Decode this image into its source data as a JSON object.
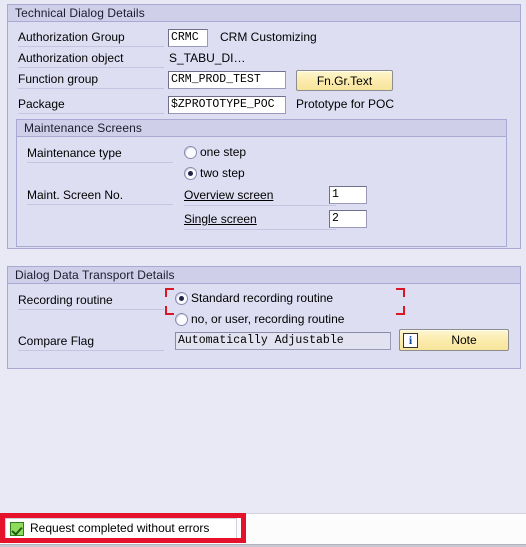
{
  "technical_dialog": {
    "title": "Technical Dialog Details",
    "rows": [
      {
        "label": "Authorization Group",
        "value": "CRMC",
        "description": "CRM Customizing"
      },
      {
        "label": "Authorization object",
        "value": "S_TABU_DI…",
        "description": ""
      },
      {
        "label": "Function group",
        "value": "CRM_PROD_TEST",
        "description": ""
      },
      {
        "label": "Package",
        "value": "$ZPROTOTYPE_POC",
        "description": "Prototype for POC"
      }
    ],
    "fn_gr_text_button": "Fn.Gr.Text"
  },
  "maintenance_screens": {
    "title": "Maintenance Screens",
    "maintenance_type_label": "Maintenance type",
    "options": [
      {
        "label": "one step",
        "selected": false
      },
      {
        "label": "two step",
        "selected": true
      }
    ],
    "screen_no_label": "Maint. Screen No.",
    "screens": [
      {
        "label": "Overview screen",
        "value": "1"
      },
      {
        "label": "Single screen",
        "value": "2"
      }
    ]
  },
  "dialog_data_transport": {
    "title": "Dialog Data Transport Details",
    "recording_routine_label": "Recording routine",
    "routines": [
      {
        "label": "Standard recording routine",
        "selected": true
      },
      {
        "label": "no, or user, recording routine",
        "selected": false
      }
    ],
    "compare_flag_label": "Compare Flag",
    "compare_flag_value": "Automatically Adjustable",
    "note_button": "Note",
    "note_icon": "info-icon"
  },
  "status_bar": {
    "icon": "success-check-icon",
    "message": "Request completed without errors"
  },
  "colors": {
    "panel": "#dedef3",
    "header": "#cfcfea",
    "border": "#a9a9d4",
    "button": "#fbecad",
    "annotation_red": "#e4122a",
    "success_green": "#8fdc5c"
  }
}
